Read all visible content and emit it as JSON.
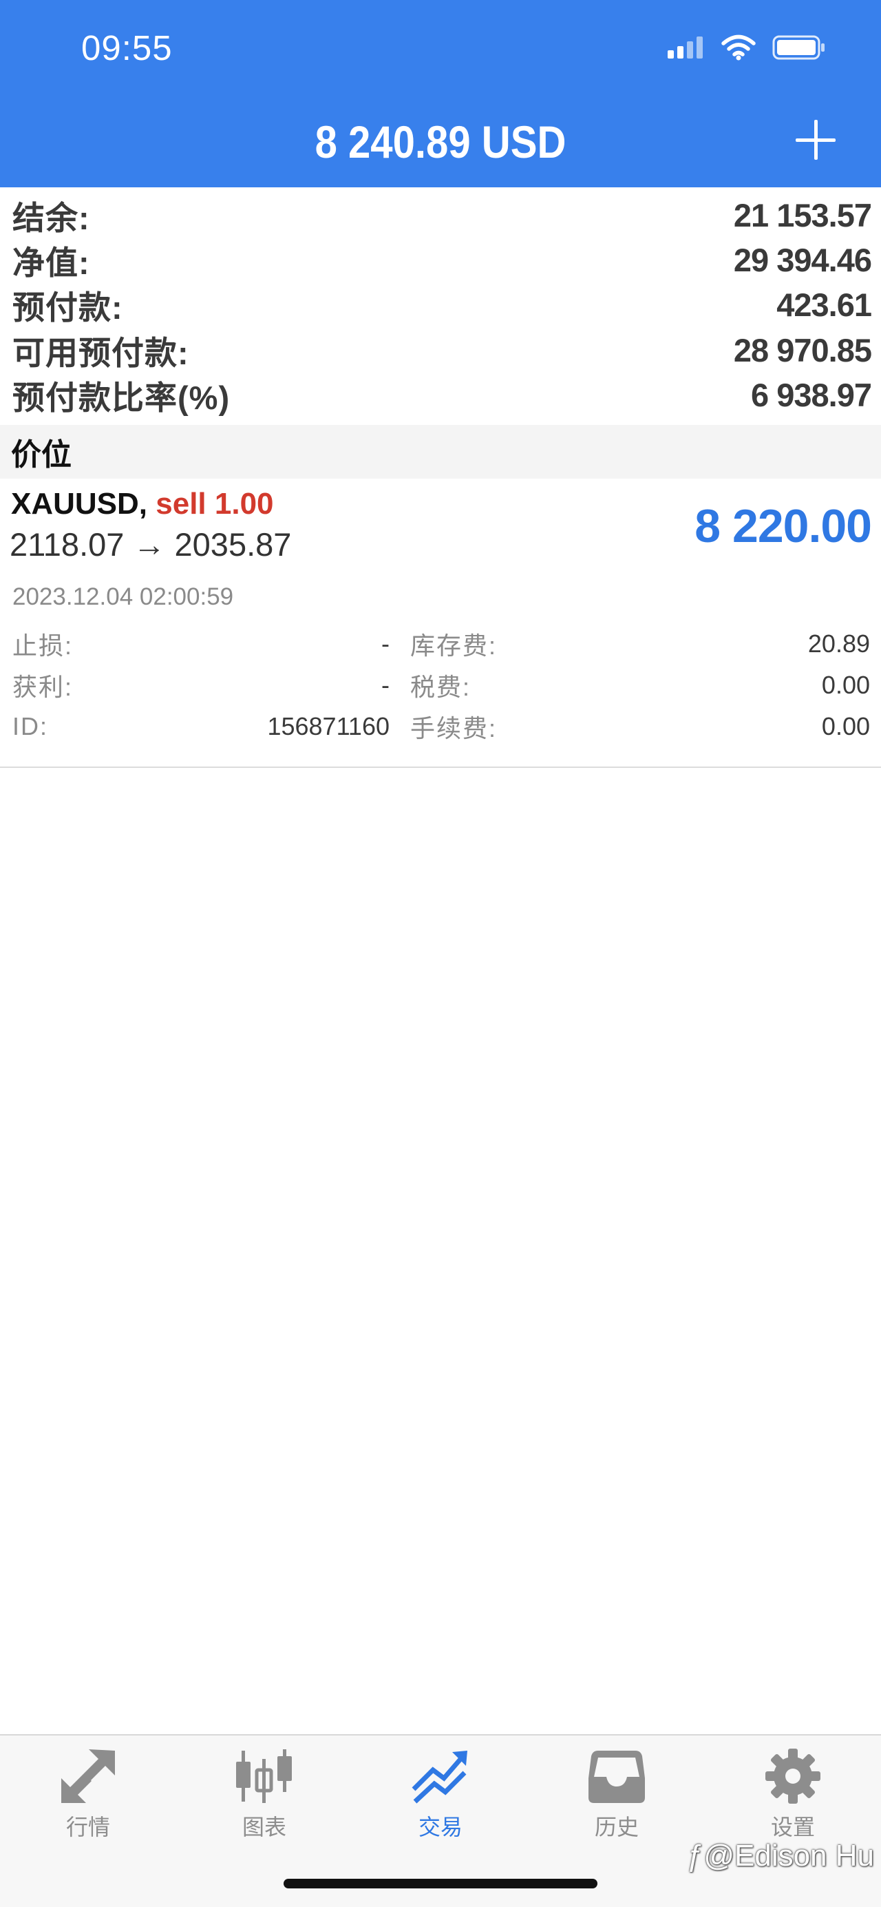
{
  "status_bar": {
    "time": "09:55"
  },
  "header": {
    "balance": "8 240.89 USD"
  },
  "summary": {
    "rows": [
      {
        "label": "结余:",
        "value": "21 153.57"
      },
      {
        "label": "净值:",
        "value": "29 394.46"
      },
      {
        "label": "预付款:",
        "value": "423.61"
      },
      {
        "label": "可用预付款:",
        "value": "28 970.85"
      },
      {
        "label": "预付款比率(%)",
        "value": "6 938.97"
      }
    ]
  },
  "positions": {
    "section_title": "价位",
    "items": [
      {
        "symbol": "XAUUSD,",
        "side": "sell 1.00",
        "prices": "2118.07 → 2035.87",
        "profit": "8 220.00",
        "time": "2023.12.04 02:00:59",
        "details": {
          "sl_label": "止损:",
          "sl_value": "-",
          "tp_label": "获利:",
          "tp_value": "-",
          "id_label": "ID:",
          "id_value": "156871160",
          "swap_label": "库存费:",
          "swap_value": "20.89",
          "tax_label": "税费:",
          "tax_value": "0.00",
          "commission_label": "手续费:",
          "commission_value": "0.00"
        }
      }
    ]
  },
  "tabs": [
    {
      "label": "行情",
      "icon": "quotes-arrows-icon",
      "active": false
    },
    {
      "label": "图表",
      "icon": "candlestick-chart-icon",
      "active": false
    },
    {
      "label": "交易",
      "icon": "trade-trend-icon",
      "active": true
    },
    {
      "label": "历史",
      "icon": "history-inbox-icon",
      "active": false
    },
    {
      "label": "设置",
      "icon": "gear-icon",
      "active": false
    }
  ],
  "watermark": "@Edison Hu",
  "colors": {
    "header_blue": "#3880ec",
    "accent_blue": "#2f78e3",
    "sell_red": "#d23a2d"
  }
}
